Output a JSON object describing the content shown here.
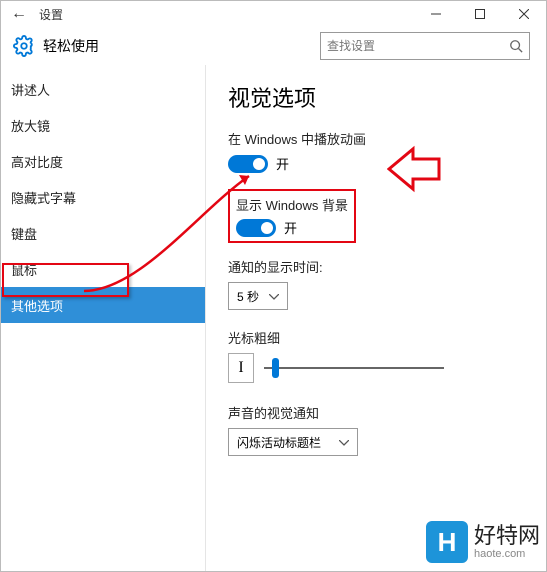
{
  "titlebar": {
    "title": "设置"
  },
  "header": {
    "title": "轻松使用"
  },
  "search": {
    "placeholder": "查找设置"
  },
  "sidebar": {
    "items": [
      {
        "label": "讲述人"
      },
      {
        "label": "放大镜"
      },
      {
        "label": "高对比度"
      },
      {
        "label": "隐藏式字幕"
      },
      {
        "label": "键盘"
      },
      {
        "label": "鼠标"
      },
      {
        "label": "其他选项"
      }
    ]
  },
  "content": {
    "section_title": "视觉选项",
    "play_anim": {
      "label": "在 Windows 中播放动画",
      "state": "开"
    },
    "show_bg": {
      "label": "显示 Windows 背景",
      "state": "开"
    },
    "notify_time": {
      "label": "通知的显示时间:",
      "value": "5 秒"
    },
    "cursor": {
      "label": "光标粗细",
      "preview": "I"
    },
    "sound_vis": {
      "label": "声音的视觉通知",
      "value": "闪烁活动标题栏"
    }
  },
  "watermark": {
    "cn": "好特网",
    "url": "haote.com",
    "logo": "H"
  }
}
